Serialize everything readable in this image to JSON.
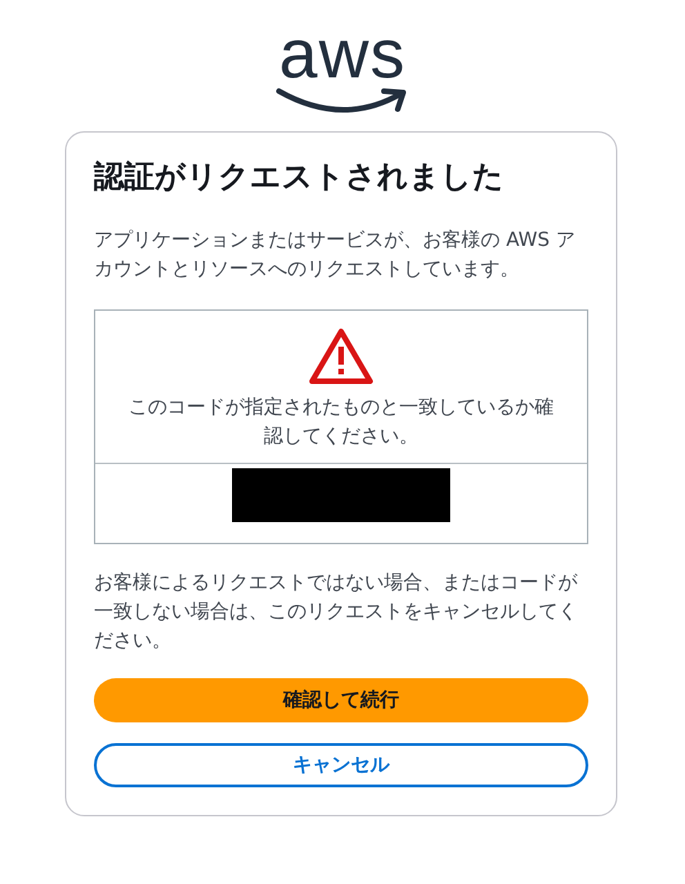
{
  "logo": {
    "text": "aws"
  },
  "card": {
    "title": "認証がリクエストされました",
    "description": "アプリケーションまたはサービスが、お客様の AWS アカウントとリソースへのリクエストしています。",
    "code_panel": {
      "message": "このコードが指定されたものと一致しているか確認してください。",
      "code_redacted": true
    },
    "note": "お客様によるリクエストではない場合、またはコードが一致しない場合は、このリクエストをキャンセルしてください。",
    "buttons": [
      {
        "label": "確認して続行",
        "kind": "primary"
      },
      {
        "label": "キャンセル",
        "kind": "secondary"
      }
    ]
  }
}
